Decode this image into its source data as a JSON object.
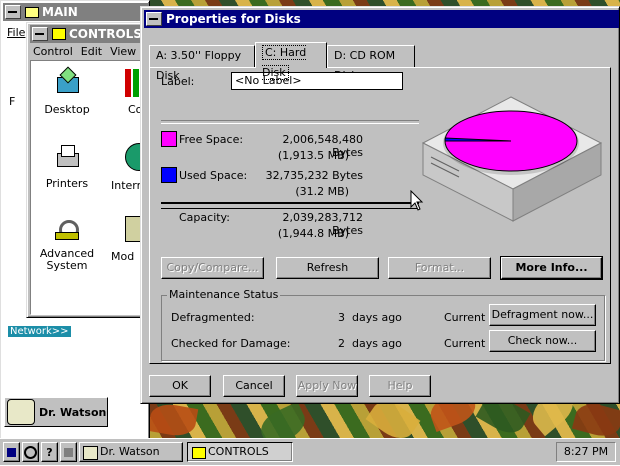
{
  "main_window": {
    "title": "MAIN",
    "menu_partial": "File"
  },
  "controls_window": {
    "title": "CONTROLS",
    "menu": [
      "Control",
      "Edit",
      "View"
    ],
    "icons": [
      {
        "label": "Desktop",
        "icon": "desktop-icon"
      },
      {
        "label": "Co",
        "icon": "color-icon"
      },
      {
        "label": "Printers",
        "icon": "printer-icon"
      },
      {
        "label": "Interna",
        "icon": "internet-icon"
      },
      {
        "label": "Advanced\nSystem",
        "icon": "advanced-system-icon"
      },
      {
        "label": "Mod",
        "icon": "modem-icon"
      }
    ],
    "left_edge_letter": "F"
  },
  "network_label": "Network>>",
  "dr_watson_label": "Dr. Watson",
  "dialog": {
    "title": "Properties for Disks",
    "tabs": [
      "A: 3.50'' Floppy Disk",
      "C: Hard Disk",
      "D: CD ROM Disk"
    ],
    "active_tab": 1,
    "label_caption": "Label:",
    "label_value": "<No Label>",
    "free": {
      "caption": "Free Space:",
      "bytes": "2,006,548,480 Bytes",
      "mb": "(1,913.5 MB)",
      "color": "#ff00ff"
    },
    "used": {
      "caption": "Used Space:",
      "bytes": "32,735,232 Bytes",
      "mb": "(31.2 MB)",
      "color": "#0000ff"
    },
    "capacity": {
      "caption": "Capacity:",
      "bytes": "2,039,283,712 Bytes",
      "mb": "(1,944.8 MB)"
    },
    "pie_used_fraction": 0.016,
    "buttons": {
      "copy": "Copy/Compare...",
      "refresh": "Refresh",
      "format": "Format...",
      "more_info": "More Info..."
    },
    "maintenance": {
      "title": "Maintenance Status",
      "rows": [
        {
          "label": "Defragmented:",
          "ago": "3  days ago",
          "status": "Current",
          "button": "Defragment now..."
        },
        {
          "label": "Checked for Damage:",
          "ago": "2  days ago",
          "status": "Current",
          "button": "Check now..."
        }
      ]
    },
    "footer": {
      "ok": "OK",
      "cancel": "Cancel",
      "apply": "Apply Now",
      "help": "Help"
    }
  },
  "taskbar": {
    "tasks": [
      {
        "label": "Dr. Watson"
      },
      {
        "label": "CONTROLS"
      }
    ],
    "clock": "8:27 PM"
  }
}
